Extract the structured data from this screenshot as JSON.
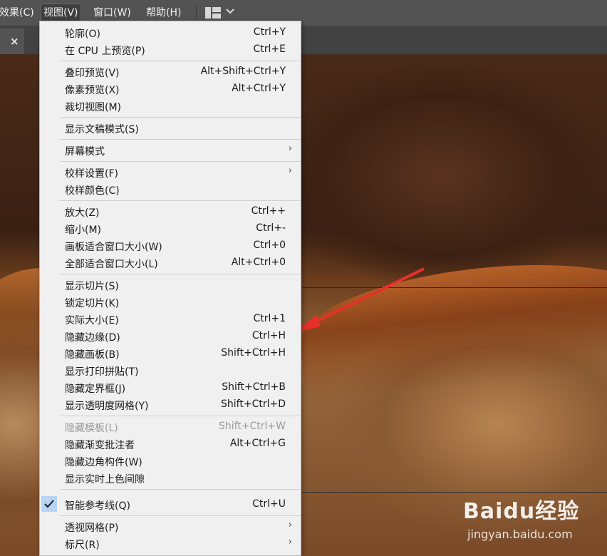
{
  "menubar": {
    "items": [
      "效果(C)",
      "视图(V)",
      "窗口(W)",
      "帮助(H)"
    ],
    "active_index": 1
  },
  "tab": {
    "close_glyph": "×"
  },
  "menu": {
    "rows": [
      {
        "label": "轮廓(O)",
        "shortcut": "Ctrl+Y"
      },
      {
        "label": "在 CPU 上预览(P)",
        "shortcut": "Ctrl+E"
      },
      {
        "label": "叠印预览(V)",
        "shortcut": "Alt+Shift+Ctrl+Y"
      },
      {
        "label": "像素预览(X)",
        "shortcut": "Alt+Ctrl+Y"
      },
      {
        "label": "裁切视图(M)",
        "shortcut": ""
      },
      {
        "label": "显示文稿模式(S)",
        "shortcut": ""
      },
      {
        "label": "屏幕模式",
        "shortcut": "",
        "submenu": true
      },
      {
        "label": "校样设置(F)",
        "shortcut": "",
        "submenu": true
      },
      {
        "label": "校样颜色(C)",
        "shortcut": ""
      },
      {
        "label": "放大(Z)",
        "shortcut": "Ctrl++"
      },
      {
        "label": "缩小(M)",
        "shortcut": "Ctrl+-"
      },
      {
        "label": "画板适合窗口大小(W)",
        "shortcut": "Ctrl+0"
      },
      {
        "label": "全部适合窗口大小(L)",
        "shortcut": "Alt+Ctrl+0"
      },
      {
        "label": "显示切片(S)",
        "shortcut": ""
      },
      {
        "label": "锁定切片(K)",
        "shortcut": ""
      },
      {
        "label": "实际大小(E)",
        "shortcut": "Ctrl+1"
      },
      {
        "label": "隐藏边缘(D)",
        "shortcut": "Ctrl+H"
      },
      {
        "label": "隐藏画板(B)",
        "shortcut": "Shift+Ctrl+H"
      },
      {
        "label": "显示打印拼贴(T)",
        "shortcut": ""
      },
      {
        "label": "隐藏定界框(J)",
        "shortcut": "Shift+Ctrl+B"
      },
      {
        "label": "显示透明度网格(Y)",
        "shortcut": "Shift+Ctrl+D"
      },
      {
        "label": "隐藏模板(L)",
        "shortcut": "Shift+Ctrl+W",
        "disabled": true
      },
      {
        "label": "隐藏渐变批注者",
        "shortcut": "Alt+Ctrl+G"
      },
      {
        "label": "隐藏边角构件(W)",
        "shortcut": ""
      },
      {
        "label": "显示实时上色间隙",
        "shortcut": ""
      },
      {
        "label": "智能参考线(Q)",
        "shortcut": "Ctrl+U",
        "checked": true
      },
      {
        "label": "透视网格(P)",
        "shortcut": "",
        "submenu": true
      },
      {
        "label": "标尺(R)",
        "shortcut": "",
        "submenu": true
      }
    ],
    "submenu_glyph": "›"
  },
  "watermark": {
    "brand": "Baidu经验",
    "url": "jingyan.baidu.com"
  },
  "colors": {
    "menubar": "#535353",
    "menu_bg": "#f0f0f0",
    "arrow": "#e8302a",
    "check_bg": "#b6d5f5"
  },
  "icons": [
    "workspace-layout-icon",
    "chevron-down-icon",
    "close-icon",
    "checkmark-icon",
    "submenu-arrow-icon",
    "annotation-arrow"
  ]
}
